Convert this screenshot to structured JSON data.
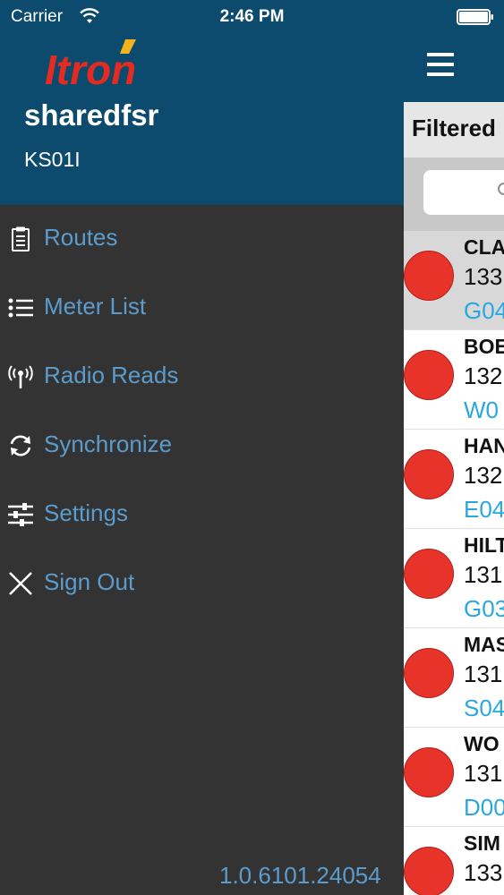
{
  "status_bar": {
    "carrier": "Carrier",
    "time": "2:46 PM"
  },
  "drawer": {
    "logo_text": "Itron",
    "user_name": "sharedfsr",
    "route_code": "KS01I",
    "menu": [
      {
        "label": "Routes",
        "icon": "clipboard-icon"
      },
      {
        "label": "Meter List",
        "icon": "list-icon"
      },
      {
        "label": "Radio Reads",
        "icon": "radio-antenna-icon"
      },
      {
        "label": "Synchronize",
        "icon": "sync-icon"
      },
      {
        "label": "Settings",
        "icon": "sliders-icon"
      },
      {
        "label": "Sign Out",
        "icon": "close-icon"
      }
    ],
    "version": "1.0.6101.24054"
  },
  "main": {
    "title": "Filtered",
    "rows": [
      {
        "name": "CLA",
        "number": "133",
        "code": "G04",
        "status_color": "#e8332a"
      },
      {
        "name": "BOE",
        "number": "132",
        "code": "W0",
        "status_color": "#e8332a"
      },
      {
        "name": "HAN",
        "number": "132",
        "code": "E04",
        "status_color": "#e8332a"
      },
      {
        "name": "HILT",
        "number": "131",
        "code": "G03",
        "status_color": "#e8332a"
      },
      {
        "name": "MAS",
        "number": "131",
        "code": "S04",
        "status_color": "#e8332a"
      },
      {
        "name": "WO",
        "number": "131",
        "code": "D00",
        "status_color": "#e8332a"
      },
      {
        "name": "SIM",
        "number": "133",
        "code": "",
        "status_color": "#e8332a"
      }
    ]
  },
  "colors": {
    "header_blue": "#0c4a6e",
    "drawer_bg": "#333333",
    "menu_text": "#5c9ccd",
    "code_text": "#29a8e0",
    "status_red": "#e8332a"
  }
}
